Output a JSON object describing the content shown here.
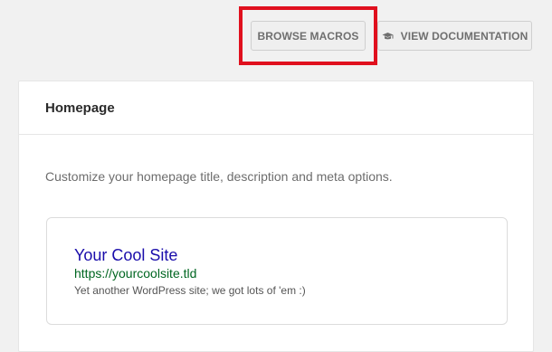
{
  "toolbar": {
    "browse_macros_label": "BROWSE MACROS",
    "view_documentation_label": "VIEW DOCUMENTATION",
    "highlight_color": "#e0101e"
  },
  "card": {
    "title": "Homepage",
    "description": "Customize your homepage title, description and meta options."
  },
  "preview": {
    "title": "Your Cool Site",
    "url": "https://yourcoolsite.tld",
    "description": "Yet another WordPress site; we got lots of 'em :)",
    "title_color": "#1a0dab",
    "url_color": "#006621"
  },
  "icons": {
    "documentation": "graduation-cap-icon"
  }
}
